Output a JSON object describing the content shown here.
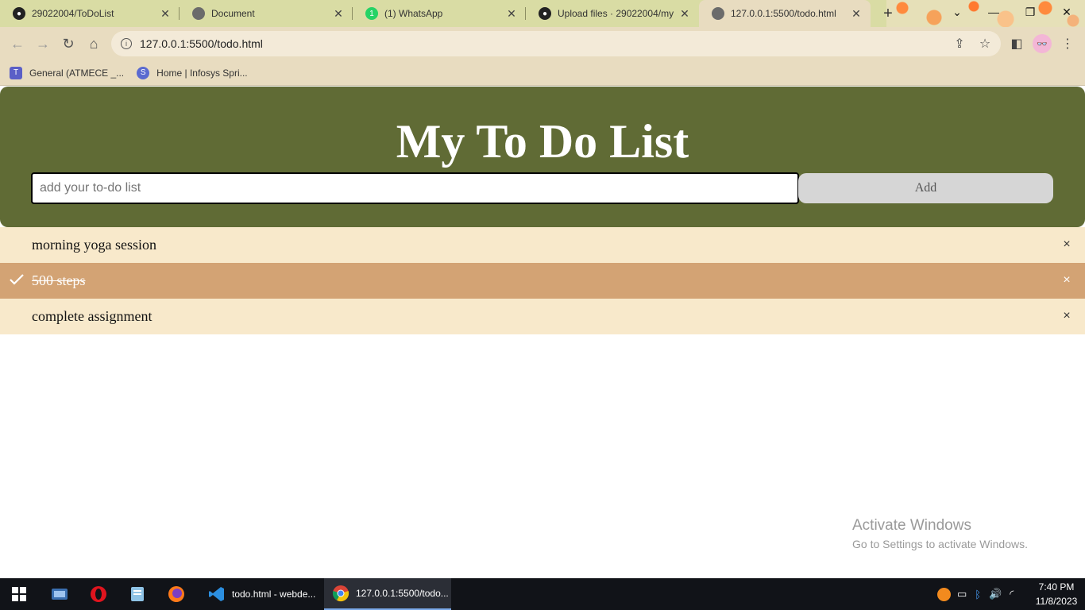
{
  "browser": {
    "tabs": [
      {
        "title": "29022004/ToDoList",
        "icon": "github-icon"
      },
      {
        "title": "Document",
        "icon": "globe-icon"
      },
      {
        "title": "(1) WhatsApp",
        "icon": "whatsapp-icon"
      },
      {
        "title": "Upload files · 29022004/my",
        "icon": "github-icon"
      },
      {
        "title": "127.0.0.1:5500/todo.html",
        "icon": "globe-icon"
      }
    ],
    "address": "127.0.0.1:5500/todo.html",
    "bookmarks": [
      {
        "label": "General (ATMECE _...",
        "icon": "teams-icon"
      },
      {
        "label": "Home | Infosys Spri...",
        "icon": "infosys-icon"
      }
    ]
  },
  "app": {
    "title": "My To Do List",
    "input_placeholder": "add your to-do list",
    "add_label": "Add",
    "items": [
      {
        "text": "morning yoga session",
        "checked": false
      },
      {
        "text": "500 steps",
        "checked": true
      },
      {
        "text": "complete assignment",
        "checked": false
      }
    ],
    "close_glyph": "×",
    "colors": {
      "header": "#606b35",
      "item": "#f8e9cb",
      "item_checked": "#d3a374",
      "add_button": "#d6d6d6"
    }
  },
  "watermark": {
    "line1": "Activate Windows",
    "line2": "Go to Settings to activate Windows."
  },
  "taskbar": {
    "apps": [
      {
        "label": "todo.html - webde...",
        "icon": "vscode-icon"
      },
      {
        "label": "127.0.0.1:5500/todo...",
        "icon": "chrome-icon"
      }
    ],
    "time": "7:40 PM",
    "date": "11/8/2023"
  }
}
